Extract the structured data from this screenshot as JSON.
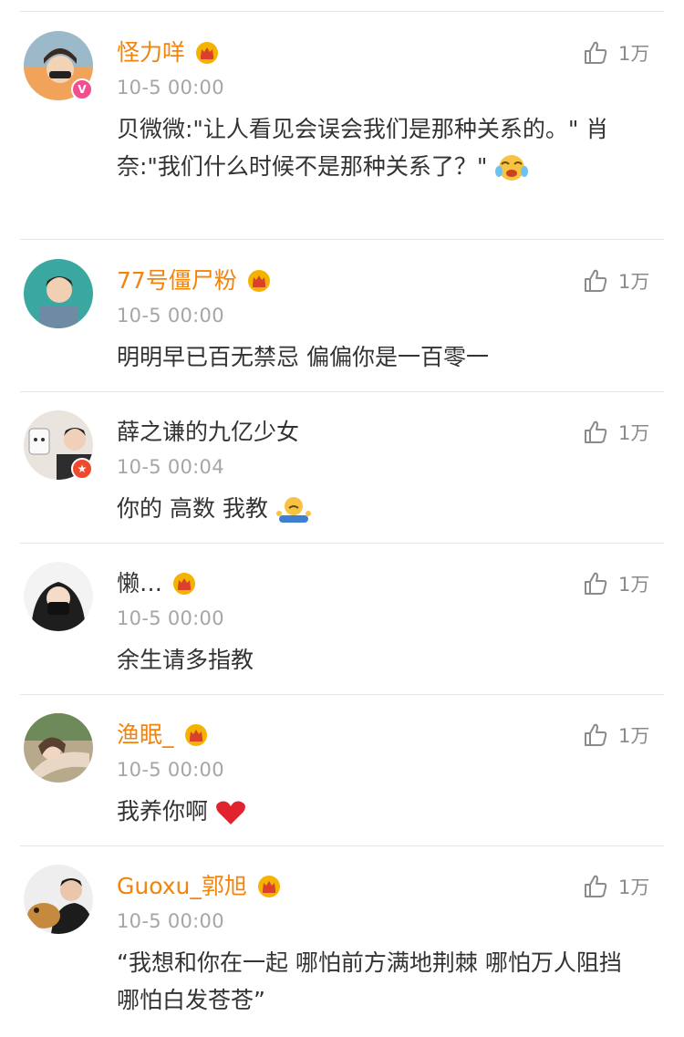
{
  "comments": [
    {
      "username": "怪力咩",
      "time": "10-5 00:00",
      "text": "贝微微:\"让人看见会误会我们是那种关系的。\" 肖奈:\"我们什么时候不是那种关系了？\"",
      "likes": "1万",
      "badge_text": "V",
      "avatar_icon": "avatar-photo",
      "trailing_emoji": "tears-of-joy-emoji"
    },
    {
      "username": "77号僵尸粉",
      "time": "10-5 00:00",
      "text": "明明早已百无禁忌  偏偏你是一百零一",
      "likes": "1万",
      "avatar_icon": "avatar-photo"
    },
    {
      "username": "薛之谦的九亿少女",
      "time": "10-5 00:04",
      "text": "你的 高数 我教",
      "likes": "1万",
      "badge_text": "★",
      "avatar_icon": "avatar-photo",
      "trailing_emoji": "shrug-emoji"
    },
    {
      "username": "懒…",
      "time": "10-5 00:00",
      "text": "余生请多指教",
      "likes": "1万",
      "avatar_icon": "avatar-photo"
    },
    {
      "username": "渔眠_",
      "time": "10-5 00:00",
      "text": "我养你啊",
      "likes": "1万",
      "avatar_icon": "avatar-photo",
      "trailing_emoji": "red-heart-emoji"
    },
    {
      "username": "Guoxu_郭旭",
      "time": "10-5 00:00",
      "text": "“我想和你在一起   哪怕前方满地荆棘   哪怕万人阻挡   哪怕白发苍苍”",
      "likes": "1万",
      "avatar_icon": "avatar-photo"
    }
  ],
  "colors": {
    "vip_name": "#f3840b",
    "plain_name": "#333333",
    "timestamp": "#a6a6a6",
    "divider": "#e6e6e6",
    "crown": "#f5b301"
  },
  "icons": {
    "like": "thumbs-up-icon",
    "member": "crown-icon"
  }
}
